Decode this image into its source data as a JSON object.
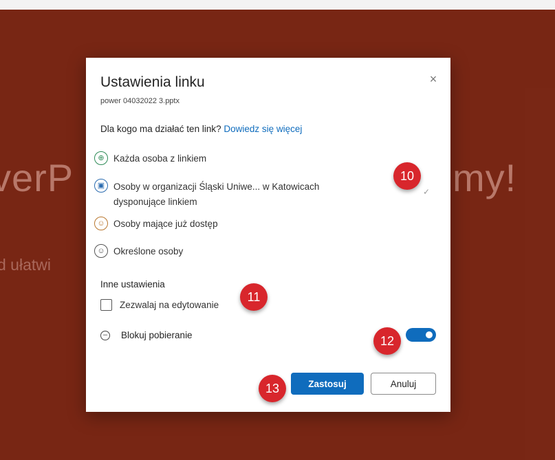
{
  "background": {
    "big_left": "verP",
    "big_right": "my!",
    "sub_left": "d ułatwi"
  },
  "dialog": {
    "title": "Ustawienia linku",
    "filename": "power 04032022 3.pptx",
    "close_icon": "×",
    "question": "Dla kogo ma działać ten link?",
    "learn_more": "Dowiedz się więcej",
    "options": [
      {
        "label": "Każda osoba z linkiem",
        "icon": "globe-icon",
        "glyph": "⊕",
        "color": "#2e8b57"
      },
      {
        "label_line1": "Osoby w organizacji Śląski Uniwe... w Katowicach",
        "label_line2": "dysponujące linkiem",
        "icon": "briefcase-icon",
        "glyph": "▣",
        "color": "#2b6cb0",
        "selected_mark": "✓"
      },
      {
        "label": "Osoby mające już dostęp",
        "icon": "people-icon",
        "glyph": "☺",
        "color": "#b9772f"
      },
      {
        "label": "Określone osoby",
        "icon": "people-icon",
        "glyph": "☺",
        "color": "#555555"
      }
    ],
    "other_settings": "Inne ustawienia",
    "allow_edit": "Zezwalaj na edytowanie",
    "block_download": "Blokuj pobieranie",
    "block_download_on": true,
    "apply": "Zastosuj",
    "cancel": "Anuluj"
  },
  "badges": [
    "10",
    "11",
    "12",
    "13"
  ],
  "colors": {
    "accent": "#0f6cbd",
    "badge": "#d8262c",
    "background": "#7e2a17"
  }
}
